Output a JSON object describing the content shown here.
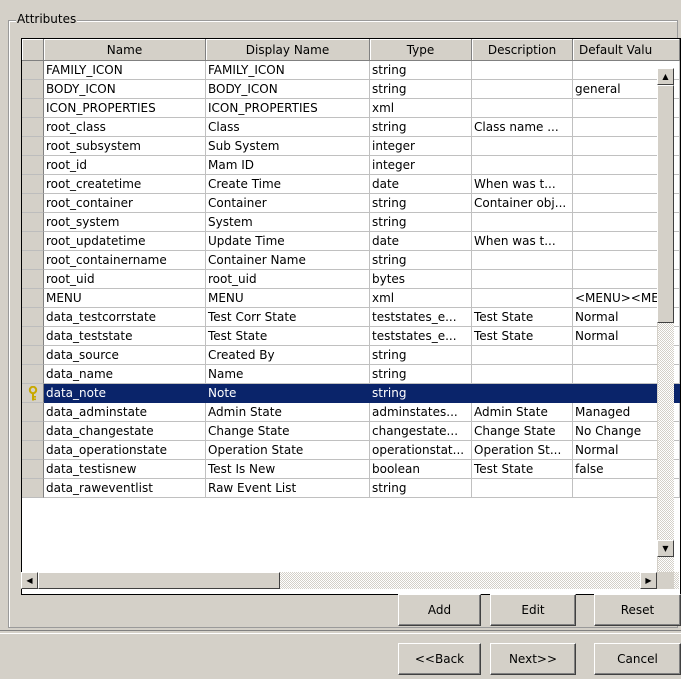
{
  "group": {
    "title": "Attributes"
  },
  "table": {
    "columns": [
      "Name",
      "Display Name",
      "Type",
      "Description",
      "Default Valu"
    ],
    "rows": [
      {
        "name": "FAMILY_ICON",
        "display": "FAMILY_ICON",
        "type": "string",
        "desc": "",
        "default": ""
      },
      {
        "name": "BODY_ICON",
        "display": "BODY_ICON",
        "type": "string",
        "desc": "",
        "default": "general"
      },
      {
        "name": "ICON_PROPERTIES",
        "display": "ICON_PROPERTIES",
        "type": "xml",
        "desc": "",
        "default": ""
      },
      {
        "name": "root_class",
        "display": "Class",
        "type": "string",
        "desc": "Class name ...",
        "default": ""
      },
      {
        "name": "root_subsystem",
        "display": "Sub System",
        "type": "integer",
        "desc": "",
        "default": ""
      },
      {
        "name": "root_id",
        "display": "Mam ID",
        "type": "integer",
        "desc": "",
        "default": ""
      },
      {
        "name": "root_createtime",
        "display": "Create Time",
        "type": "date",
        "desc": "When was t...",
        "default": ""
      },
      {
        "name": "root_container",
        "display": "Container",
        "type": "string",
        "desc": "Container obj...",
        "default": ""
      },
      {
        "name": "root_system",
        "display": "System",
        "type": "string",
        "desc": "",
        "default": ""
      },
      {
        "name": "root_updatetime",
        "display": "Update Time",
        "type": "date",
        "desc": "When was t...",
        "default": ""
      },
      {
        "name": "root_containername",
        "display": "Container Name",
        "type": "string",
        "desc": "",
        "default": ""
      },
      {
        "name": "root_uid",
        "display": "root_uid",
        "type": "bytes",
        "desc": "",
        "default": ""
      },
      {
        "name": "MENU",
        "display": "MENU",
        "type": "xml",
        "desc": "",
        "default": "<MENU><ME"
      },
      {
        "name": "data_testcorrstate",
        "display": "Test Corr State",
        "type": "teststates_e...",
        "desc": "Test State",
        "default": "Normal"
      },
      {
        "name": "data_teststate",
        "display": "Test State",
        "type": "teststates_e...",
        "desc": "Test State",
        "default": "Normal"
      },
      {
        "name": "data_source",
        "display": "Created By",
        "type": "string",
        "desc": "",
        "default": ""
      },
      {
        "name": "data_name",
        "display": "Name",
        "type": "string",
        "desc": "",
        "default": ""
      },
      {
        "name": "data_note",
        "display": "Note",
        "type": "string",
        "desc": "",
        "default": "",
        "selected": true
      },
      {
        "name": "data_adminstate",
        "display": "Admin State",
        "type": "adminstates...",
        "desc": "Admin State",
        "default": "Managed"
      },
      {
        "name": "data_changestate",
        "display": "Change State",
        "type": "changestate...",
        "desc": "Change State",
        "default": "No Change"
      },
      {
        "name": "data_operationstate",
        "display": "Operation State",
        "type": "operationstat...",
        "desc": "Operation St...",
        "default": "Normal"
      },
      {
        "name": "data_testisnew",
        "display": "Test Is New",
        "type": "boolean",
        "desc": "Test State",
        "default": "false"
      },
      {
        "name": "data_raweventlist",
        "display": "Raw Event List",
        "type": "string",
        "desc": "",
        "default": ""
      }
    ]
  },
  "scroll": {
    "up": "▲",
    "down": "▼",
    "left": "◀",
    "right": "▶"
  },
  "buttons": {
    "add": "Add",
    "edit": "Edit",
    "reset": "Reset",
    "back": "<<Back",
    "next": "Next>>",
    "cancel": "Cancel"
  },
  "colors": {
    "selection": "#0a246a",
    "key_icon": "#c8a800"
  }
}
